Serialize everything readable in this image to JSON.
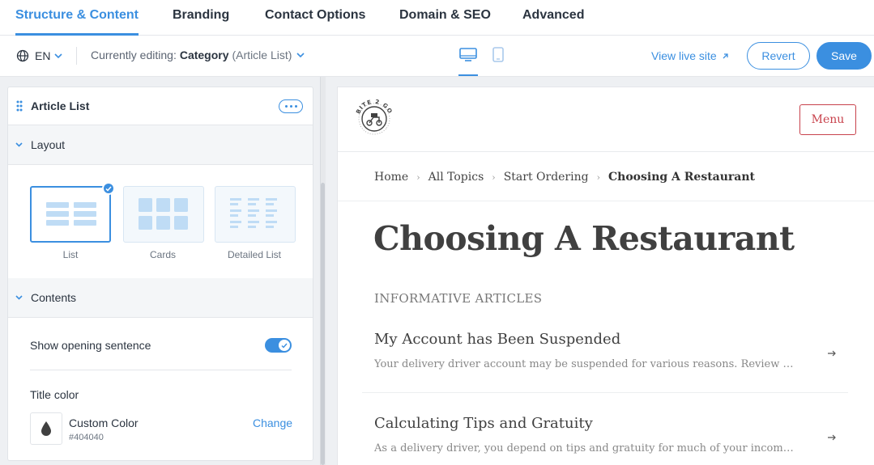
{
  "tabs": [
    {
      "label": "Structure & Content",
      "active": true
    },
    {
      "label": "Branding"
    },
    {
      "label": "Contact Options"
    },
    {
      "label": "Domain & SEO"
    },
    {
      "label": "Advanced"
    }
  ],
  "toolbar": {
    "language": "EN",
    "editing_prefix": "Currently editing:",
    "editing_category": "Category",
    "editing_type": "(Article List)",
    "view_live": "View live site",
    "revert": "Revert",
    "save": "Save",
    "accent_color": "#3b8fe0"
  },
  "panel": {
    "title": "Article List",
    "layout_section": "Layout",
    "layouts": [
      {
        "label": "List",
        "selected": true
      },
      {
        "label": "Cards"
      },
      {
        "label": "Detailed List"
      }
    ],
    "contents_section": "Contents",
    "show_opening_sentence": "Show opening sentence",
    "show_opening_sentence_on": true,
    "title_color_label": "Title color",
    "custom_color_name": "Custom Color",
    "custom_color_hex": "#404040",
    "change": "Change"
  },
  "preview": {
    "logo_text": "BITE 2 GO",
    "menu": "Menu",
    "breadcrumbs": [
      "Home",
      "All Topics",
      "Start Ordering",
      "Choosing A Restaurant"
    ],
    "page_title": "Choosing A Restaurant",
    "section_label": "INFORMATIVE ARTICLES",
    "articles": [
      {
        "title": "My Account has Been Suspended",
        "desc": "Your delivery driver account may be suspended for various reasons. Review the reasons below"
      },
      {
        "title": "Calculating Tips and Gratuity",
        "desc": "As a delivery driver, you depend on tips and gratuity for much of your income. Learn how"
      }
    ],
    "menu_color": "#c8424c"
  }
}
